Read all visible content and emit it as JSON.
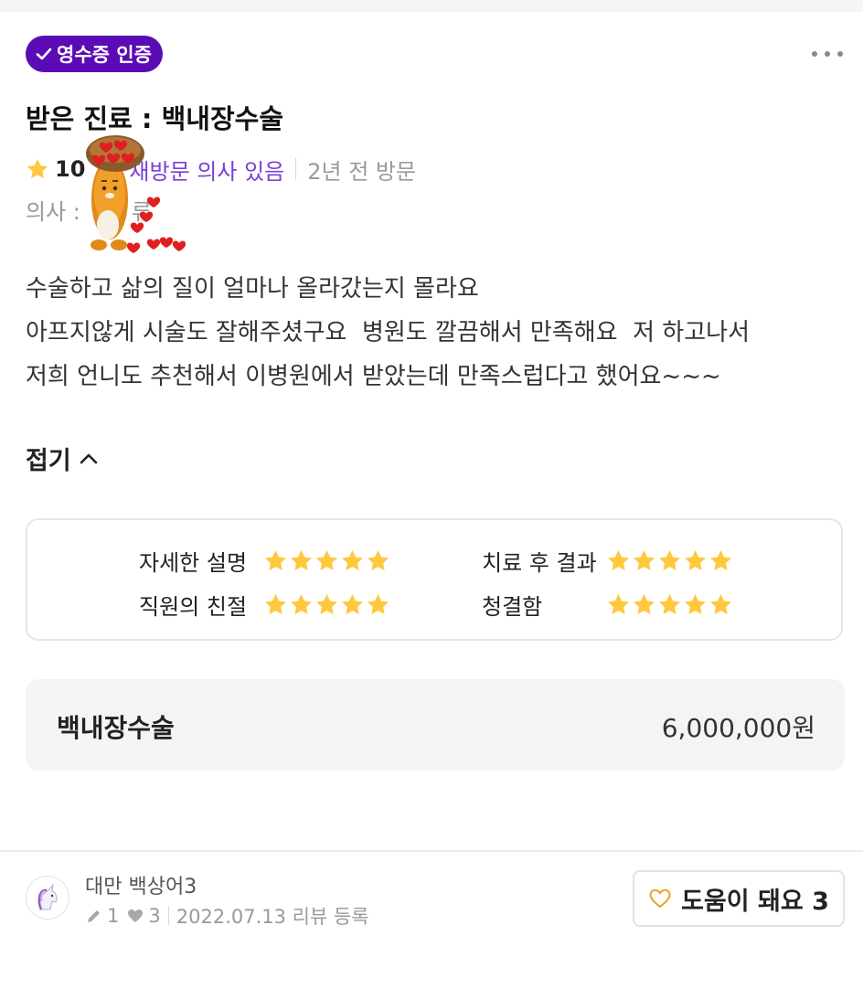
{
  "badge": {
    "label": "영수증 인증"
  },
  "review": {
    "title": "받은 진료 :  백내장수술",
    "score": "10",
    "revisit": "재방문 의사 있음",
    "visit": "2년 전 방문",
    "doctor_label": "의사 :",
    "doctor_name": "류",
    "body": "수술하고 삶의 질이 얼마나 올라갔는지 몰라요\n아프지않게 시술도 잘해주셨구요  병원도 깔끔해서 만족해요  저 하고나서\n저희 언니도 추천해서 이병원에서 받았는데 만족스럽다고 했어요~~~",
    "fold_label": "접기"
  },
  "ratings": [
    {
      "label": "자세한 설명",
      "stars": 5
    },
    {
      "label": "치료 후 결과",
      "stars": 5
    },
    {
      "label": "직원의 친절",
      "stars": 5
    },
    {
      "label": "청결함",
      "stars": 5
    }
  ],
  "price": {
    "name": "백내장수술",
    "value": "6,000,000원"
  },
  "user": {
    "name": "대만 백상어3",
    "posts": "1",
    "likes": "3",
    "date": "2022.07.13 리뷰 등록"
  },
  "helpful": {
    "label": "도움이 돼요 3"
  },
  "colors": {
    "badge": "#5b0bb5",
    "revisit": "#7a3fd6",
    "star": "#ffc83d",
    "heart": "#f0a020"
  },
  "icons": [
    "check-icon",
    "more-icon",
    "star-icon",
    "chevron-up-icon",
    "pencil-icon",
    "heart-icon",
    "unicorn-avatar"
  ]
}
